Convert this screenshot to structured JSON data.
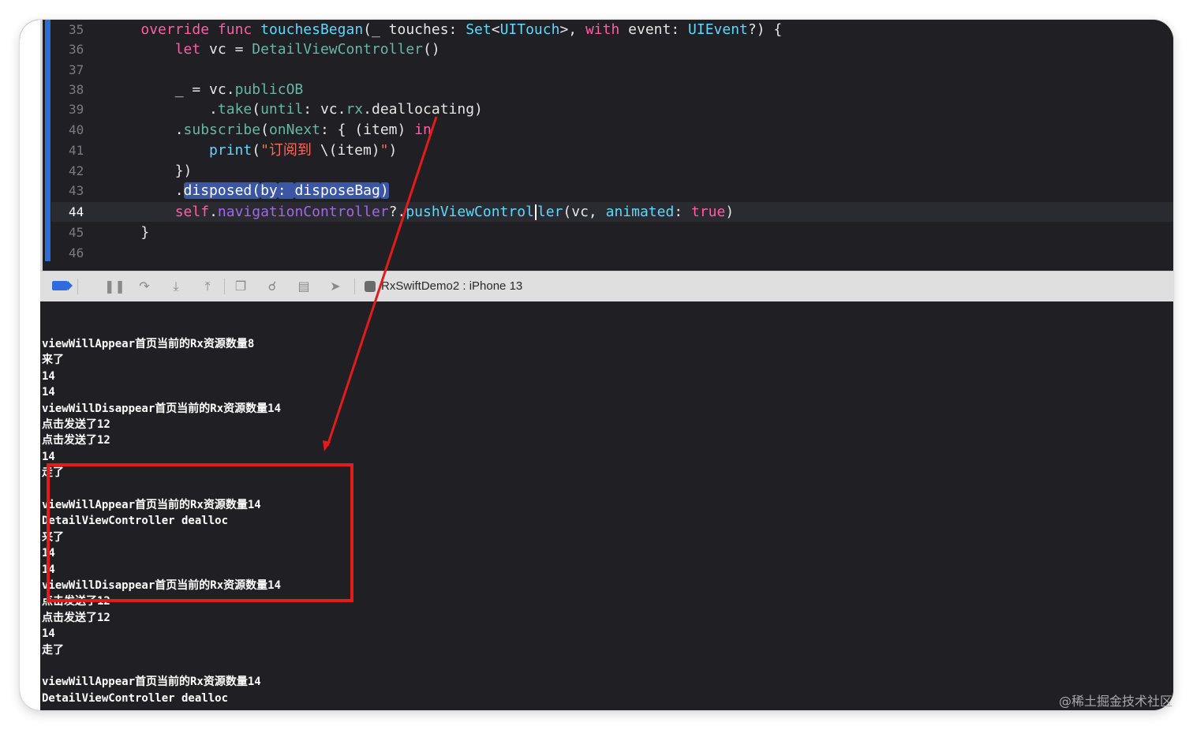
{
  "editor": {
    "lines": [
      {
        "n": "35",
        "tokens": [
          {
            "t": "    ",
            "c": "pl"
          },
          {
            "t": "override",
            "c": "kw"
          },
          {
            "t": " ",
            "c": "pl"
          },
          {
            "t": "func",
            "c": "kw"
          },
          {
            "t": " ",
            "c": "pl"
          },
          {
            "t": "touchesBegan",
            "c": "ty"
          },
          {
            "t": "(_ ",
            "c": "pl"
          },
          {
            "t": "touches",
            "c": "pl"
          },
          {
            "t": ": ",
            "c": "pl"
          },
          {
            "t": "Set",
            "c": "ty"
          },
          {
            "t": "<",
            "c": "pl"
          },
          {
            "t": "UITouch",
            "c": "ty"
          },
          {
            "t": ">, ",
            "c": "pl"
          },
          {
            "t": "with",
            "c": "kw"
          },
          {
            "t": " event: ",
            "c": "pl"
          },
          {
            "t": "UIEvent",
            "c": "ty"
          },
          {
            "t": "?) {",
            "c": "pl"
          }
        ]
      },
      {
        "n": "36",
        "tokens": [
          {
            "t": "        ",
            "c": "pl"
          },
          {
            "t": "let",
            "c": "kw"
          },
          {
            "t": " vc = ",
            "c": "pl"
          },
          {
            "t": "DetailViewController",
            "c": "fn"
          },
          {
            "t": "()",
            "c": "pl"
          }
        ]
      },
      {
        "n": "37",
        "tokens": []
      },
      {
        "n": "38",
        "tokens": [
          {
            "t": "        _ = vc.",
            "c": "pl"
          },
          {
            "t": "publicOB",
            "c": "fn"
          }
        ]
      },
      {
        "n": "39",
        "tokens": [
          {
            "t": "            .",
            "c": "pl"
          },
          {
            "t": "take",
            "c": "fn"
          },
          {
            "t": "(",
            "c": "pl"
          },
          {
            "t": "until",
            "c": "fn"
          },
          {
            "t": ": vc.",
            "c": "pl"
          },
          {
            "t": "rx",
            "c": "fn"
          },
          {
            "t": ".deallocating)",
            "c": "pl"
          }
        ]
      },
      {
        "n": "40",
        "tokens": [
          {
            "t": "        .",
            "c": "pl"
          },
          {
            "t": "subscribe",
            "c": "fn"
          },
          {
            "t": "(",
            "c": "pl"
          },
          {
            "t": "onNext",
            "c": "fn"
          },
          {
            "t": ": { (item) ",
            "c": "pl"
          },
          {
            "t": "in",
            "c": "kw"
          }
        ]
      },
      {
        "n": "41",
        "tokens": [
          {
            "t": "            ",
            "c": "pl"
          },
          {
            "t": "print",
            "c": "ty"
          },
          {
            "t": "(",
            "c": "pl"
          },
          {
            "t": "\"订阅到 ",
            "c": "st"
          },
          {
            "t": "\\(item)",
            "c": "pl"
          },
          {
            "t": "\"",
            "c": "st"
          },
          {
            "t": ")",
            "c": "pl"
          }
        ]
      },
      {
        "n": "42",
        "tokens": [
          {
            "t": "        })",
            "c": "pl"
          }
        ]
      },
      {
        "n": "43",
        "tokens": [
          {
            "t": "        .",
            "c": "pl"
          },
          {
            "t": "disposed(",
            "c": "sel"
          },
          {
            "t": "by",
            "c": "sel"
          },
          {
            "t": ": ",
            "c": "sel"
          },
          {
            "t": "disposeBag",
            "c": "sel"
          },
          {
            "t": ")",
            "c": "sel"
          }
        ]
      },
      {
        "n": "44",
        "current": true,
        "tokens": [
          {
            "t": "        ",
            "c": "pl"
          },
          {
            "t": "self",
            "c": "kw"
          },
          {
            "t": ".",
            "c": "pl"
          },
          {
            "t": "navigationController",
            "c": "fg"
          },
          {
            "t": "?.",
            "c": "pl"
          },
          {
            "t": "pushViewContro",
            "c": "ty"
          },
          {
            "t": "l",
            "c": "ty"
          },
          {
            "t": "|",
            "c": "caret"
          },
          {
            "t": "ler",
            "c": "ty"
          },
          {
            "t": "(vc, ",
            "c": "pl"
          },
          {
            "t": "animated",
            "c": "ty"
          },
          {
            "t": ": ",
            "c": "pl"
          },
          {
            "t": "true",
            "c": "kw"
          },
          {
            "t": ")",
            "c": "pl"
          }
        ]
      },
      {
        "n": "45",
        "tokens": [
          {
            "t": "    }",
            "c": "pl"
          }
        ]
      },
      {
        "n": "46",
        "tokens": []
      }
    ]
  },
  "debugbar": {
    "icons": [
      "breakpoints-icon",
      "pause-icon",
      "step-over-icon",
      "step-into-icon",
      "step-out-icon",
      "debug-view-hierarchy-icon",
      "memory-graph-icon",
      "environment-overrides-icon",
      "simulate-location-icon"
    ],
    "scheme": "RxSwiftDemo2 : iPhone 13"
  },
  "console": {
    "lines": [
      "viewWillAppear首页当前的Rx资源数量8",
      "来了",
      "14",
      "14",
      "viewWillDisappear首页当前的Rx资源数量14",
      "点击发送了12",
      "点击发送了12",
      "14",
      "走了",
      "",
      "viewWillAppear首页当前的Rx资源数量14",
      "DetailViewController dealloc",
      "来了",
      "14",
      "14",
      "viewWillDisappear首页当前的Rx资源数量14",
      "点击发送了12",
      "点击发送了12",
      "14",
      "走了",
      "",
      "viewWillAppear首页当前的Rx资源数量14",
      "DetailViewController dealloc"
    ]
  },
  "colors": {
    "annotation": "#e21b1b",
    "breakpoint": "#2f6bdc"
  },
  "watermark": "@稀土掘金技术社区"
}
